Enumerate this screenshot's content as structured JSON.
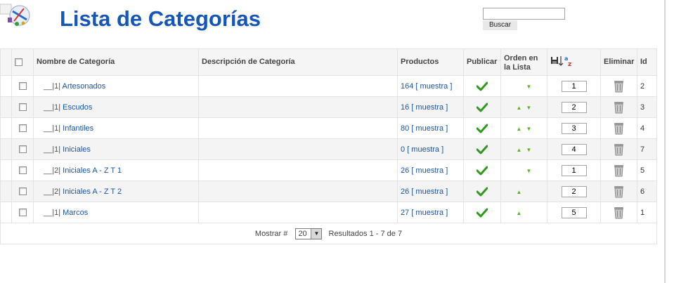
{
  "header": {
    "title": "Lista de Categorías",
    "search_button": "Buscar",
    "search_value": ""
  },
  "columns": {
    "name": "Nombre de Categoría",
    "description": "Descripción de Categoría",
    "products": "Productos",
    "publish": "Publicar",
    "order_line1": "Orden en",
    "order_line2": "la Lista",
    "delete": "Eliminar",
    "id": "Id"
  },
  "rows": [
    {
      "prefix": "__|1|",
      "name": "Artesonados",
      "count": "164",
      "show": "[ muestra ]",
      "up": false,
      "down": true,
      "order": "1",
      "id": "2"
    },
    {
      "prefix": "__|1|",
      "name": "Escudos",
      "count": "16",
      "show": "[ muestra ]",
      "up": true,
      "down": true,
      "order": "2",
      "id": "3"
    },
    {
      "prefix": "__|1|",
      "name": "Infantiles",
      "count": "80",
      "show": "[ muestra ]",
      "up": true,
      "down": true,
      "order": "3",
      "id": "4"
    },
    {
      "prefix": "__|1|",
      "name": "Iniciales",
      "count": "0",
      "show": "[ muestra ]",
      "up": true,
      "down": true,
      "order": "4",
      "id": "7"
    },
    {
      "prefix": "__|2|",
      "name": "Iniciales A - Z T 1",
      "count": "26",
      "show": "[ muestra ]",
      "up": false,
      "down": true,
      "order": "1",
      "id": "5"
    },
    {
      "prefix": "__|2|",
      "name": "Iniciales A - Z T 2",
      "count": "26",
      "show": "[ muestra ]",
      "up": true,
      "down": false,
      "order": "2",
      "id": "6"
    },
    {
      "prefix": "__|1|",
      "name": "Marcos",
      "count": "27",
      "show": "[ muestra ]",
      "up": true,
      "down": false,
      "order": "5",
      "id": "1"
    }
  ],
  "footer": {
    "show_label": "Mostrar #",
    "page_size": "20",
    "results": "Resultados 1 - 7 de 7"
  },
  "colors": {
    "title": "#1656b8",
    "link": "#1a55a8",
    "check": "#2e9a1a",
    "arrow": "#5cb21e"
  }
}
